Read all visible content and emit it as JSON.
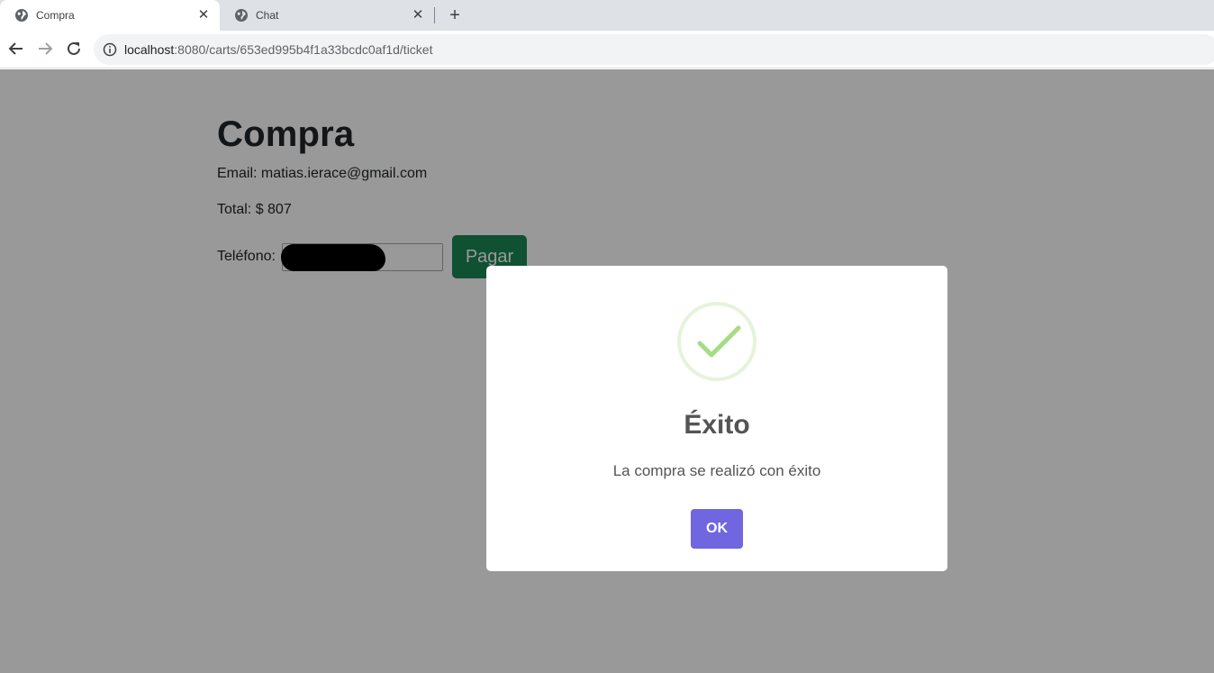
{
  "browser": {
    "tabs": [
      {
        "title": "Compra",
        "active": true
      },
      {
        "title": "Chat",
        "active": false
      }
    ],
    "new_tab_symbol": "+",
    "close_symbol": "✕",
    "url_host": "localhost",
    "url_rest": ":8080/carts/653ed995b4f1a33bcdc0af1d/ticket"
  },
  "page": {
    "title": "Compra",
    "email_line": "Email: matias.ierace@gmail.com",
    "total_line": "Total: $ 807",
    "phone_label": "Teléfono:",
    "pay_button": "Pagar"
  },
  "modal": {
    "icon": "success-check-icon",
    "title": "Éxito",
    "text": "La compra se realizó con éxito",
    "ok_button": "OK"
  },
  "colors": {
    "pay_button": "#198754",
    "ok_button": "#7066e0",
    "success": "#a5dc86"
  }
}
